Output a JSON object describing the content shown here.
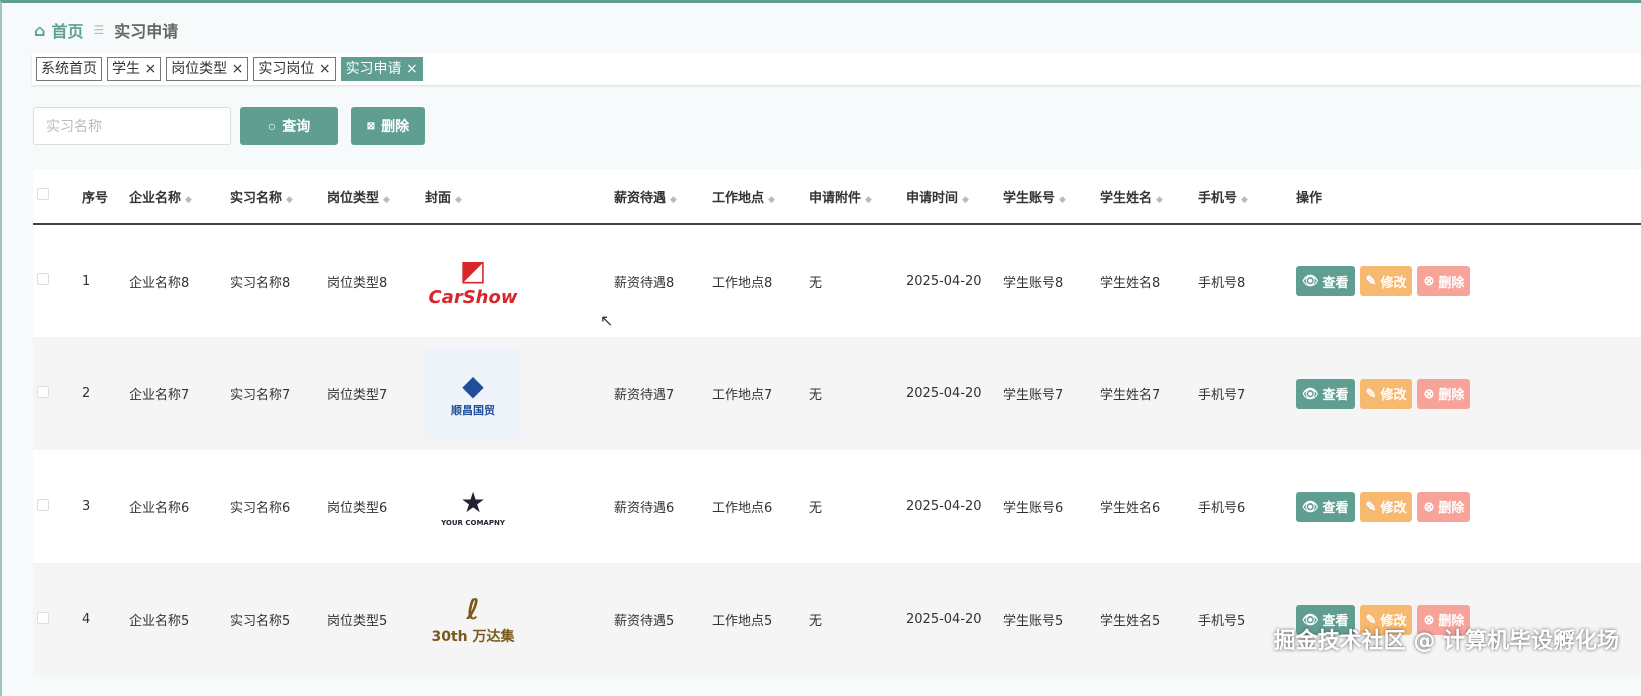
{
  "breadcrumb": {
    "home": "首页",
    "current": "实习申请"
  },
  "tabs": [
    {
      "label": "系统首页"
    },
    {
      "label": "学生 ×"
    },
    {
      "label": "岗位类型 ×"
    },
    {
      "label": "实习岗位 ×"
    },
    {
      "label": "实习申请 ×",
      "active": true
    }
  ],
  "search": {
    "placeholder": "实习名称",
    "value": ""
  },
  "buttons": {
    "query": "查询",
    "delete": "删除"
  },
  "columns": [
    "序号",
    "企业名称",
    "实习名称",
    "岗位类型",
    "封面",
    "薪资待遇",
    "工作地点",
    "申请附件",
    "申请时间",
    "学生账号",
    "学生姓名",
    "手机号",
    "操作"
  ],
  "row_actions": {
    "view": "查看",
    "edit": "修改",
    "delete": "删除"
  },
  "rows": [
    {
      "no": "1",
      "company": "企业名称8",
      "name": "实习名称8",
      "type": "岗位类型8",
      "logo": "CarShow",
      "salary": "薪资待遇8",
      "place": "工作地点8",
      "attach": "无",
      "time": "2025-04-20",
      "account": "学生账号8",
      "student": "学生姓名8",
      "phone": "手机号8"
    },
    {
      "no": "2",
      "company": "企业名称7",
      "name": "实习名称7",
      "type": "岗位类型7",
      "logo": "顺昌国贸",
      "salary": "薪资待遇7",
      "place": "工作地点7",
      "attach": "无",
      "time": "2025-04-20",
      "account": "学生账号7",
      "student": "学生姓名7",
      "phone": "手机号7"
    },
    {
      "no": "3",
      "company": "企业名称6",
      "name": "实习名称6",
      "type": "岗位类型6",
      "logo": "YOUR COMAPNY",
      "salary": "薪资待遇6",
      "place": "工作地点6",
      "attach": "无",
      "time": "2025-04-20",
      "account": "学生账号6",
      "student": "学生姓名6",
      "phone": "手机号6"
    },
    {
      "no": "4",
      "company": "企业名称5",
      "name": "实习名称5",
      "type": "岗位类型5",
      "logo": "30th 万达集",
      "salary": "薪资待遇5",
      "place": "工作地点5",
      "attach": "无",
      "time": "2025-04-20",
      "account": "学生账号5",
      "student": "学生姓名5",
      "phone": "手机号5"
    }
  ],
  "watermark": "掘金技术社区 @ 计算机毕设孵化场"
}
